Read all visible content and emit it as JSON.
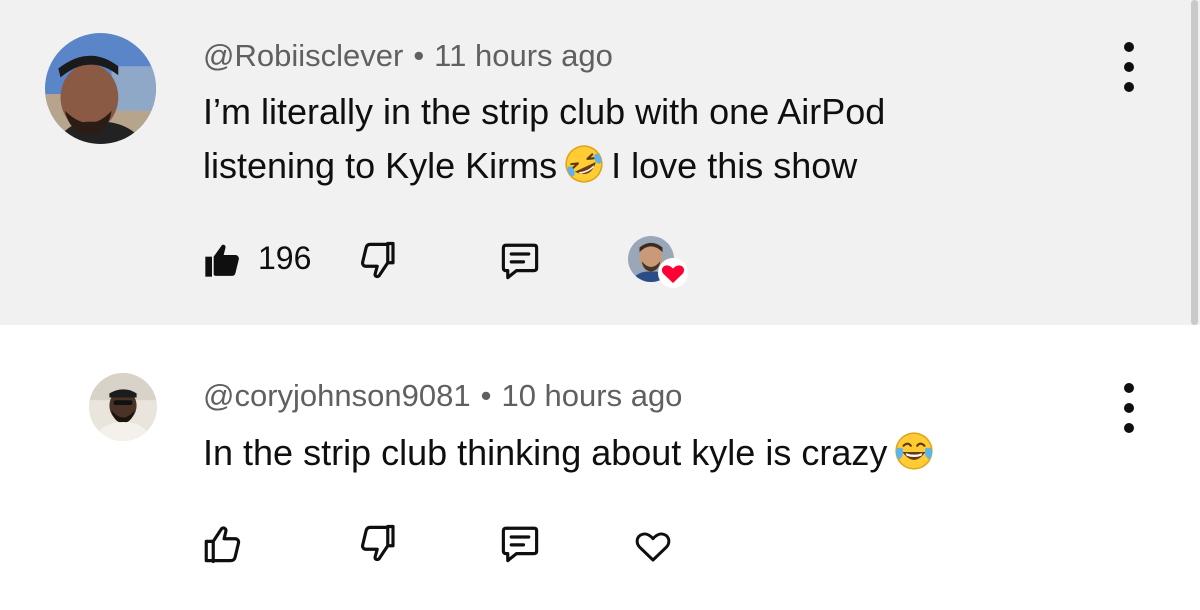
{
  "comments": [
    {
      "handle": "@Robiisclever",
      "separator": "•",
      "time": "11 hours ago",
      "text_line1": "I’m literally in the strip club with one AirPod",
      "text_line2_before_emoji": "listening to Kyle Kirms",
      "emoji": "rolling-on-floor-laughing",
      "text_line2_after_emoji": "I love this show",
      "like_count": "196",
      "liked": true,
      "creator_hearted": true
    },
    {
      "handle": "@coryjohnson9081",
      "separator": "•",
      "time": "10 hours ago",
      "text_before_emoji": "In the strip club thinking about kyle is crazy",
      "emoji": "face-with-tears-of-joy",
      "liked": false
    }
  ],
  "colors": {
    "highlight_bg": "#f1f1f1",
    "meta_text": "#606060",
    "heart_red": "#ff0033",
    "scrollbar": "#c9c9c9"
  }
}
